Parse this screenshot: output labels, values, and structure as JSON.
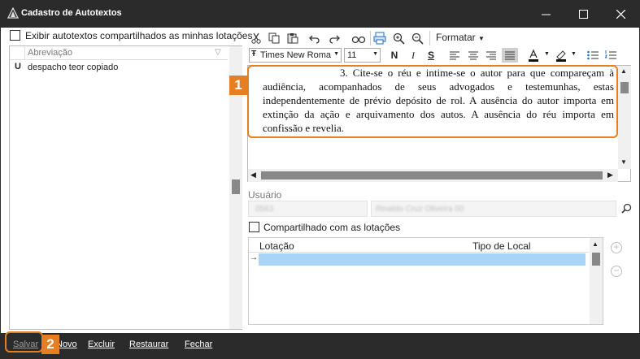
{
  "window": {
    "title": "Cadastro de Autotextos",
    "minimize_glyph": "—",
    "maximize_glyph": "☐",
    "close_glyph": "✕"
  },
  "left": {
    "show_shared_label": "Exibir autotextos compartilhados as minhas lotações",
    "grid_header": "Abreviação",
    "rows": [
      {
        "icon": "U",
        "label": "despacho teor copiado"
      }
    ]
  },
  "toolbar": {
    "icons": [
      "cut-icon",
      "copy-icon",
      "paste-icon",
      "undo-icon",
      "redo-icon",
      "find-icon",
      "print-icon",
      "zoom-in-icon",
      "zoom-out-icon"
    ],
    "format_menu": "Formatar",
    "font_name": "Times New Roma",
    "font_size": "11",
    "bold": "N",
    "italic": "I",
    "underline": "S"
  },
  "editor": {
    "text": "3. Cite-se o réu e intime-se o autor para que compareçam à audiência, acompanhados de seus advogados e testemunhas, estas independentemente de prévio depósito de rol. A ausência do autor importa em extinção da ação e arquivamento dos autos. A ausência do réu importa em confissão e revelia."
  },
  "user": {
    "label": "Usuário",
    "code_value": "0563",
    "name_value": "Rinaldo Cruz Oliveira 00"
  },
  "sharing": {
    "checkbox_label": "Compartilhado com as lotações",
    "columns": [
      "Lotação",
      "Tipo de Local"
    ],
    "row_marker": "→"
  },
  "callouts": {
    "editor_badge": "1",
    "save_badge": "2"
  },
  "footer": {
    "save": "Salvar",
    "new": "Novo",
    "delete": "Excluir",
    "restore": "Restaurar",
    "close": "Fechar"
  },
  "colors": {
    "accent": "#e67e22",
    "titlebar": "#2b2b2b",
    "selection": "#a8d4f5"
  }
}
